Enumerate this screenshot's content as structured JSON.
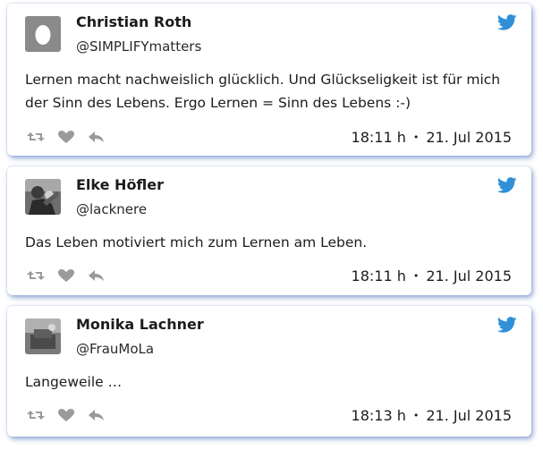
{
  "colors": {
    "twitter_blue": "#2f8fd8",
    "icon_gray": "#9a9a9a",
    "card_shadow": "#466ebe"
  },
  "tweets": [
    {
      "name": "Christian Roth",
      "handle": "@SIMPLIFYmatters",
      "text": "Lernen macht nachweislich glücklich. Und Glückseligkeit ist für mich der Sinn des Lebens. Ergo Lernen = Sinn des Lebens :-)",
      "time": "18:11 h",
      "separator": "•",
      "date": "21. Jul 2015",
      "avatar_icon": "default-egg-avatar"
    },
    {
      "name": "Elke Höfler",
      "handle": "@lacknere",
      "text": "Das Leben motiviert mich zum Lernen am Leben.",
      "time": "18:11 h",
      "separator": "•",
      "date": "21. Jul 2015",
      "avatar_icon": "photo-avatar"
    },
    {
      "name": "Monika Lachner",
      "handle": "@FrauMoLa",
      "text": "Langeweile …",
      "time": "18:13 h",
      "separator": "•",
      "date": "21. Jul 2015",
      "avatar_icon": "photo-avatar"
    }
  ],
  "action_icons": [
    "retweet-icon",
    "like-icon",
    "reply-icon"
  ]
}
